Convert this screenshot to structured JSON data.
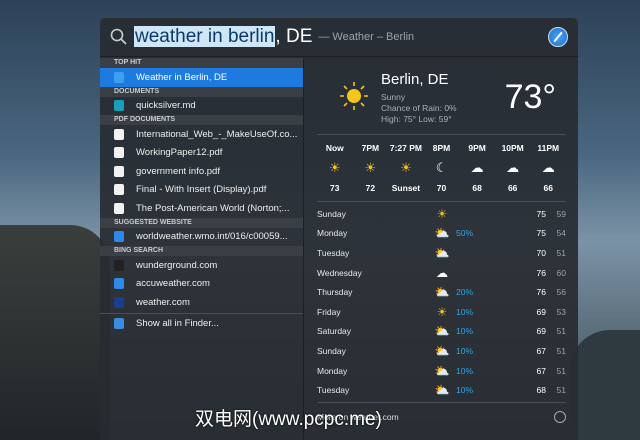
{
  "search": {
    "query_selected": "weather in berlin",
    "query_rest": ", DE",
    "hint": "— Weather – Berlin"
  },
  "sections": [
    {
      "title": "TOP HIT",
      "items": [
        {
          "label": "Weather in Berlin, DE",
          "icon": "weather-icon",
          "active": true
        }
      ]
    },
    {
      "title": "DOCUMENTS",
      "items": [
        {
          "label": "quicksilver.md",
          "icon": "markdown-icon"
        }
      ]
    },
    {
      "title": "PDF DOCUMENTS",
      "items": [
        {
          "label": "International_Web_-_MakeUseOf.co...",
          "icon": "pdf-icon"
        },
        {
          "label": "WorkingPaper12.pdf",
          "icon": "pdf-icon"
        },
        {
          "label": "government info.pdf",
          "icon": "pdf-icon"
        },
        {
          "label": "Final - With Insert (Display).pdf",
          "icon": "pdf-icon"
        },
        {
          "label": "The Post-American World (Norton;...",
          "icon": "pdf-icon"
        }
      ]
    },
    {
      "title": "SUGGESTED WEBSITE",
      "items": [
        {
          "label": "worldweather.wmo.int/016/c00059...",
          "icon": "safari-icon"
        }
      ]
    },
    {
      "title": "BING SEARCH",
      "items": [
        {
          "label": "wunderground.com",
          "icon": "wunderground-icon"
        },
        {
          "label": "accuweather.com",
          "icon": "safari-icon"
        },
        {
          "label": "weather.com",
          "icon": "weather-channel-icon"
        }
      ]
    }
  ],
  "show_all": "Show all in Finder...",
  "weather": {
    "city": "Berlin, DE",
    "condition": "Sunny",
    "rain": "Chance of Rain: 0%",
    "highlow": "High: 75°  Low: 59°",
    "temp": "73°",
    "hours": [
      {
        "t": "Now",
        "i": "☀",
        "v": "73"
      },
      {
        "t": "7PM",
        "i": "☀",
        "v": "72"
      },
      {
        "t": "7:27 PM",
        "i": "☀",
        "v": "Sunset"
      },
      {
        "t": "8PM",
        "i": "☾",
        "v": "70"
      },
      {
        "t": "9PM",
        "i": "☁",
        "v": "68"
      },
      {
        "t": "10PM",
        "i": "☁",
        "v": "66"
      },
      {
        "t": "11PM",
        "i": "☁",
        "v": "66"
      }
    ],
    "days": [
      {
        "d": "Sunday",
        "i": "☀",
        "p": "",
        "h": "75",
        "l": "59"
      },
      {
        "d": "Monday",
        "i": "⛅",
        "p": "50%",
        "h": "75",
        "l": "54"
      },
      {
        "d": "Tuesday",
        "i": "⛅",
        "p": "",
        "h": "70",
        "l": "51"
      },
      {
        "d": "Wednesday",
        "i": "☁",
        "p": "",
        "h": "76",
        "l": "60"
      },
      {
        "d": "Thursday",
        "i": "⛅",
        "p": "20%",
        "h": "76",
        "l": "56"
      },
      {
        "d": "Friday",
        "i": "☀",
        "p": "10%",
        "h": "69",
        "l": "53"
      },
      {
        "d": "Saturday",
        "i": "⛅",
        "p": "10%",
        "h": "69",
        "l": "51"
      },
      {
        "d": "Sunday",
        "i": "⛅",
        "p": "10%",
        "h": "67",
        "l": "51"
      },
      {
        "d": "Monday",
        "i": "⛅",
        "p": "10%",
        "h": "67",
        "l": "51"
      },
      {
        "d": "Tuesday",
        "i": "⛅",
        "p": "10%",
        "h": "68",
        "l": "51"
      }
    ],
    "footer": "More on weather.com"
  },
  "watermark": "双电网(www.pcpc.me)"
}
